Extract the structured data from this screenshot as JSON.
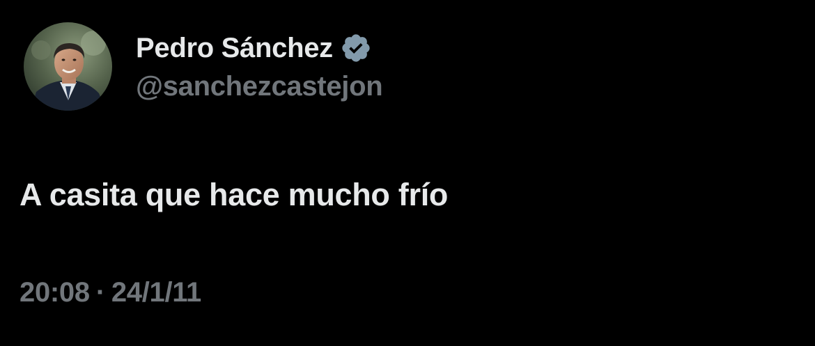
{
  "tweet": {
    "author": {
      "display_name": "Pedro Sánchez",
      "handle": "@sanchezcastejon",
      "verified": true,
      "verified_icon": "verified-badge-icon",
      "avatar": "profile-photo"
    },
    "text": "A casita que hace mucho frío",
    "time": "20:08",
    "separator": "·",
    "date": "24/1/11"
  },
  "colors": {
    "background": "#000000",
    "primary_text": "#e7e9ea",
    "secondary_text": "#71767b",
    "verified_badge": "#829aab"
  }
}
